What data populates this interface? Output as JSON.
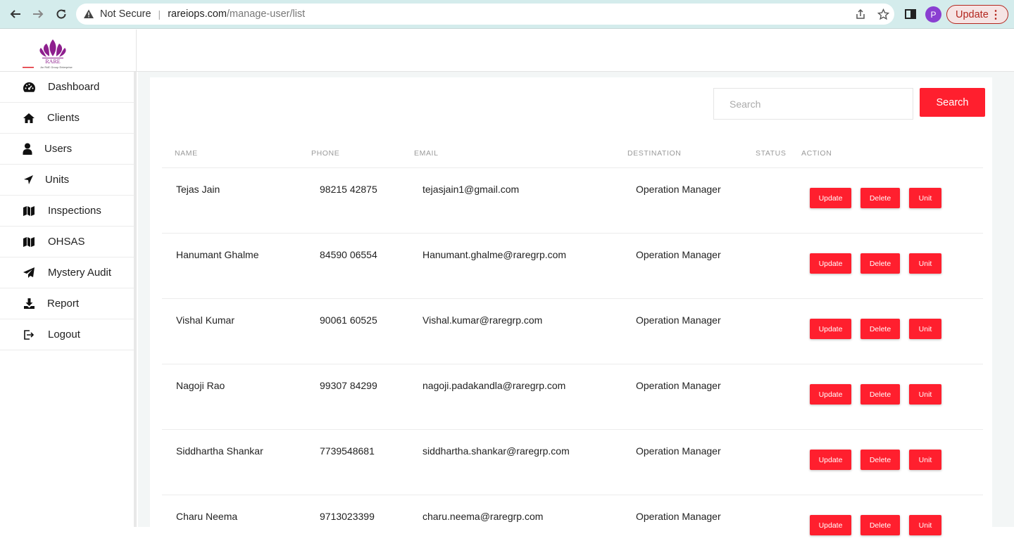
{
  "browser": {
    "security_label": "Not Secure",
    "url_domain": "rareiops.com",
    "url_path": "/manage-user/list",
    "profile_initial": "P",
    "update_label": "Update"
  },
  "logo": {
    "text": "RARE",
    "tagline": "An RdE Group Enterprise"
  },
  "sidebar": {
    "items": [
      {
        "label": "Dashboard",
        "icon": "dashboard-icon"
      },
      {
        "label": "Clients",
        "icon": "home-icon"
      },
      {
        "label": "Users",
        "icon": "user-icon"
      },
      {
        "label": "Units",
        "icon": "location-arrow-icon"
      },
      {
        "label": "Inspections",
        "icon": "map-icon"
      },
      {
        "label": "OHSAS",
        "icon": "map-icon"
      },
      {
        "label": "Mystery Audit",
        "icon": "paper-plane-icon"
      },
      {
        "label": "Report",
        "icon": "download-icon"
      },
      {
        "label": "Logout",
        "icon": "logout-icon"
      }
    ]
  },
  "search": {
    "placeholder": "Search",
    "button_label": "Search"
  },
  "table": {
    "headers": [
      "NAME",
      "PHONE",
      "EMAIL",
      "DESTINATION",
      "STATUS",
      "ACTION"
    ],
    "action_labels": {
      "update": "Update",
      "delete": "Delete",
      "unit": "Unit"
    },
    "rows": [
      {
        "name": "Tejas Jain",
        "phone": "98215 42875",
        "email": "tejasjain1@gmail.com",
        "destination": "Operation Manager"
      },
      {
        "name": "Hanumant Ghalme",
        "phone": "84590 06554",
        "email": "Hanumant.ghalme@raregrp.com",
        "destination": "Operation Manager"
      },
      {
        "name": "Vishal Kumar",
        "phone": "90061 60525",
        "email": "Vishal.kumar@raregrp.com",
        "destination": "Operation Manager"
      },
      {
        "name": "Nagoji Rao",
        "phone": "99307 84299",
        "email": "nagoji.padakandla@raregrp.com",
        "destination": "Operation Manager"
      },
      {
        "name": "Siddhartha Shankar",
        "phone": "7739548681",
        "email": "siddhartha.shankar@raregrp.com",
        "destination": "Operation Manager"
      },
      {
        "name": "Charu Neema",
        "phone": "9713023399",
        "email": "charu.neema@raregrp.com",
        "destination": "Operation Manager"
      }
    ]
  },
  "colors": {
    "accent": "#ff1f2e",
    "browser_bar": "#d4ecec"
  }
}
